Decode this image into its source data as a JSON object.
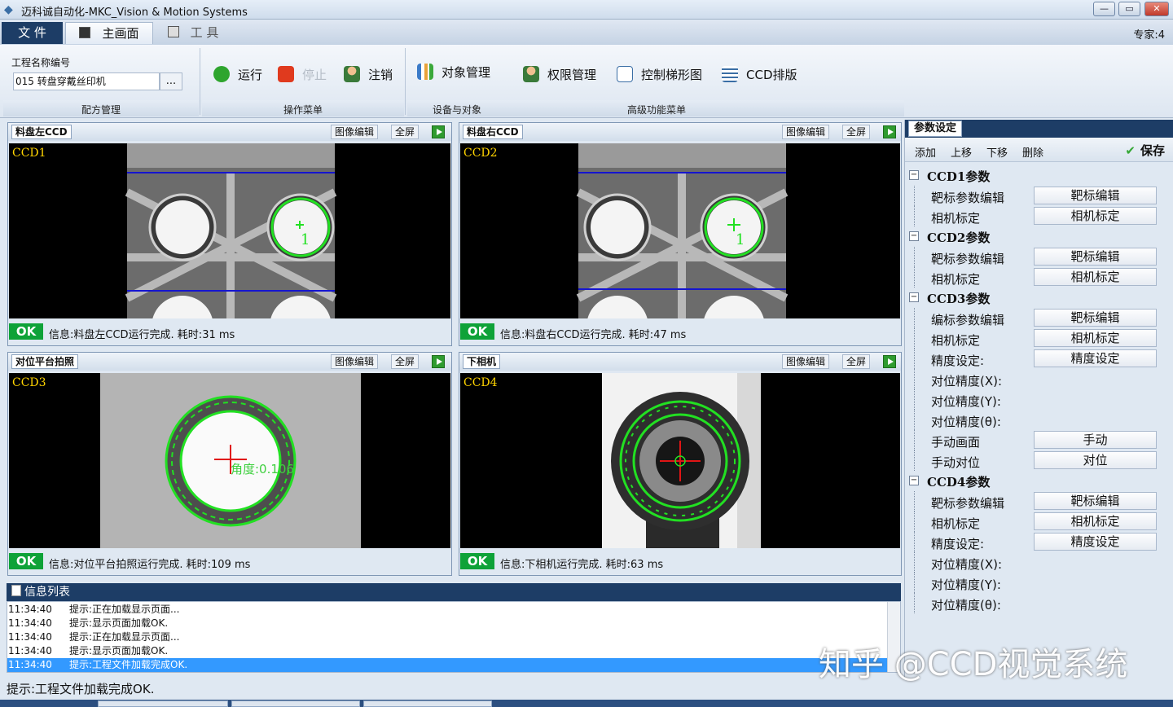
{
  "window": {
    "title": "迈科诚自动化-MKC_Vision & Motion Systems",
    "min": "—",
    "max": "▭",
    "close": "✕"
  },
  "menu": {
    "file": "文 件",
    "main": "主画面",
    "tools": "工 具",
    "expert": "专家:4"
  },
  "ribbon": {
    "project_label": "工程名称编号",
    "project_value": "015 转盘穿戴丝印机",
    "browse": "...",
    "run": "运行",
    "stop": "停止",
    "logout": "注销",
    "object_mgmt": "对象管理",
    "perm_mgmt": "权限管理",
    "ladder": "控制梯形图",
    "ccd_layout": "CCD排版",
    "groups": {
      "recipe": "配方管理",
      "ops": "操作菜单",
      "devices": "设备与对象",
      "advanced": "高级功能菜单"
    }
  },
  "panels": [
    {
      "title": "料盘左CCD",
      "ccd": "CCD1",
      "edit": "图像编辑",
      "full": "全屏",
      "ok": "OK",
      "msg": "信息:料盘左CCD运行完成. 耗时:31 ms"
    },
    {
      "title": "料盘右CCD",
      "ccd": "CCD2",
      "edit": "图像编辑",
      "full": "全屏",
      "ok": "OK",
      "msg": "信息:料盘右CCD运行完成. 耗时:47 ms"
    },
    {
      "title": "对位平台拍照",
      "ccd": "CCD3",
      "edit": "图像编辑",
      "full": "全屏",
      "ok": "OK",
      "msg": "信息:对位平台拍照运行完成. 耗时:109 ms"
    },
    {
      "title": "下相机",
      "ccd": "CCD4",
      "edit": "图像编辑",
      "full": "全屏",
      "ok": "OK",
      "msg": "信息:下相机运行完成. 耗时:63 ms"
    }
  ],
  "overlays": {
    "one": "1",
    "angle": "角度:0.106"
  },
  "params": {
    "tab": "参数设定",
    "add": "添加",
    "up": "上移",
    "down": "下移",
    "delete": "删除",
    "save": "保存",
    "tree": [
      {
        "type": "head",
        "label": "CCD1参数"
      },
      {
        "type": "item",
        "label": "靶标参数编辑",
        "btn": "靶标编辑"
      },
      {
        "type": "item",
        "label": "相机标定",
        "btn": "相机标定"
      },
      {
        "type": "head",
        "label": "CCD2参数"
      },
      {
        "type": "item",
        "label": "靶标参数编辑",
        "btn": "靶标编辑"
      },
      {
        "type": "item",
        "label": "相机标定",
        "btn": "相机标定"
      },
      {
        "type": "head",
        "label": "CCD3参数"
      },
      {
        "type": "item",
        "label": "编标参数编辑",
        "btn": "靶标编辑"
      },
      {
        "type": "item",
        "label": "相机标定",
        "btn": "相机标定"
      },
      {
        "type": "item",
        "label": "精度设定:",
        "btn": "精度设定"
      },
      {
        "type": "item",
        "label": "对位精度(X):",
        "btn": ""
      },
      {
        "type": "item",
        "label": "对位精度(Y):",
        "btn": ""
      },
      {
        "type": "item",
        "label": "对位精度(θ):",
        "btn": ""
      },
      {
        "type": "item",
        "label": "手动画面",
        "btn": "手动"
      },
      {
        "type": "item",
        "label": "手动对位",
        "btn": "对位"
      },
      {
        "type": "head",
        "label": "CCD4参数"
      },
      {
        "type": "item",
        "label": "靶标参数编辑",
        "btn": "靶标编辑"
      },
      {
        "type": "item",
        "label": "相机标定",
        "btn": "相机标定"
      },
      {
        "type": "item",
        "label": "精度设定:",
        "btn": "精度设定"
      },
      {
        "type": "item",
        "label": "对位精度(X):",
        "btn": ""
      },
      {
        "type": "item",
        "label": "对位精度(Y):",
        "btn": ""
      },
      {
        "type": "item",
        "label": "对位精度(θ):",
        "btn": ""
      }
    ]
  },
  "info": {
    "title": "信息列表",
    "rows": [
      {
        "time": "11:34:40",
        "msg": "提示:正在加载显示页面..."
      },
      {
        "time": "11:34:40",
        "msg": "提示:显示页面加载OK."
      },
      {
        "time": "11:34:40",
        "msg": "提示:正在加载显示页面..."
      },
      {
        "time": "11:34:40",
        "msg": "提示:显示页面加载OK."
      },
      {
        "time": "11:34:40",
        "msg": "提示:工程文件加载完成OK."
      }
    ]
  },
  "status": "提示:工程文件加载完成OK.",
  "watermark": "知乎 @CCD视觉系统",
  "colors": {
    "dark_blue": "#1d3d66",
    "ok_green": "#0ea238",
    "detect_green": "#22e022",
    "ccd_label": "#ffd400",
    "selection": "#3399ff"
  }
}
